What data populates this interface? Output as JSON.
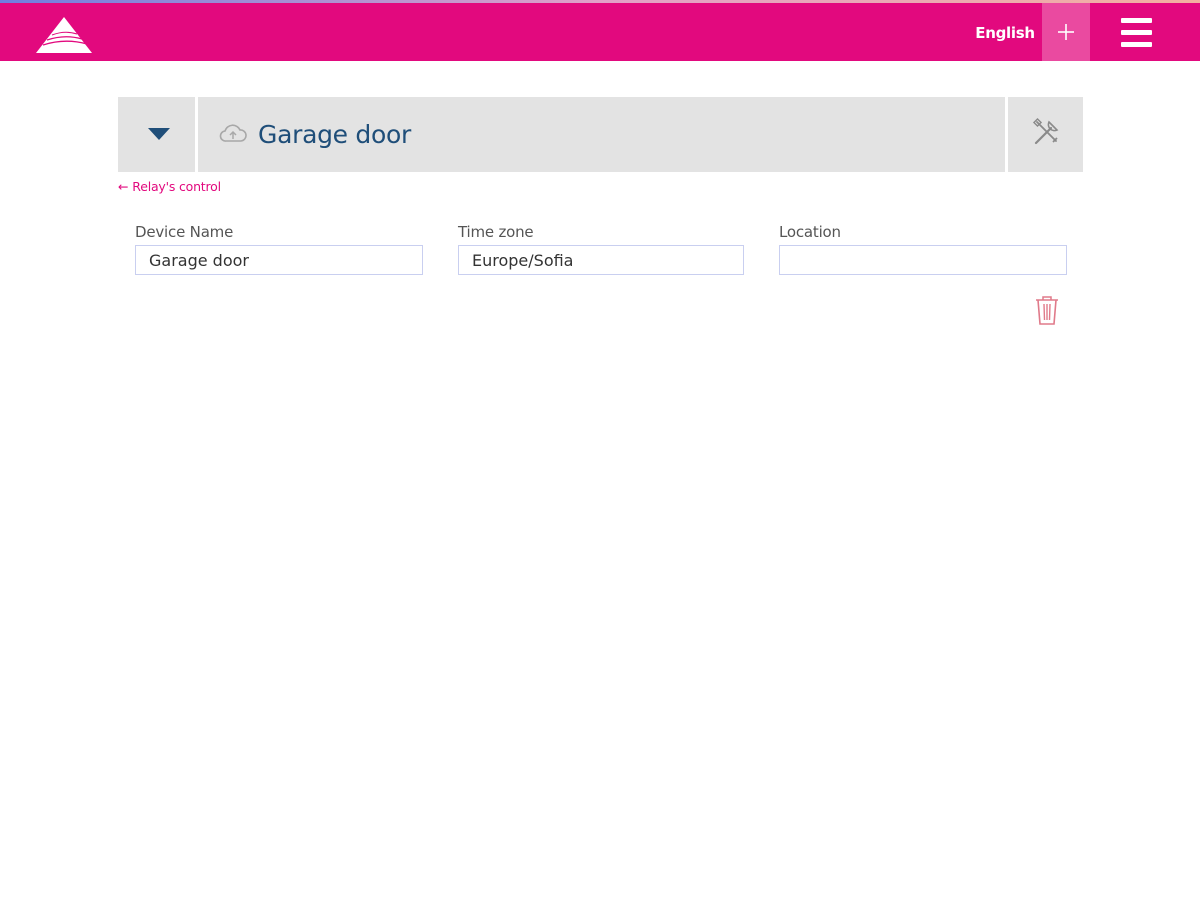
{
  "header": {
    "logo_icon": "pyramid-logo-icon",
    "language_label": "English",
    "add_icon": "plus-icon",
    "menu_icon": "hamburger-menu-icon",
    "color": "#e2097e"
  },
  "device": {
    "title": "Garage door",
    "collapse_icon": "caret-down-icon",
    "status_icon": "cloud-upload-icon",
    "settings_icon": "tools-icon"
  },
  "back_link": {
    "arrow": "←",
    "label": "Relay's control"
  },
  "form": {
    "device_name": {
      "label": "Device Name",
      "value": "Garage door"
    },
    "time_zone": {
      "label": "Time zone",
      "value": "Europe/Sofia"
    },
    "location": {
      "label": "Location",
      "value": ""
    }
  },
  "delete_icon": "trash-icon"
}
